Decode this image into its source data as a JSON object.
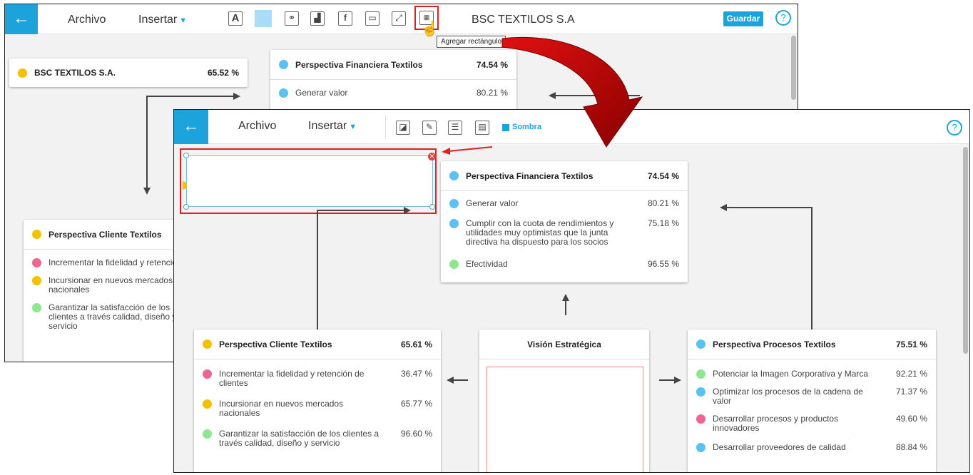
{
  "back_window": {
    "menu": {
      "archivo": "Archivo",
      "insertar": "Insertar"
    },
    "title": "BSC TEXTILOS S.A",
    "save_label": "Guardar",
    "help_label": "?",
    "tooltip": "Agregar rectángulo",
    "cards": {
      "bsc": {
        "title": "BSC TEXTILOS S.A.",
        "pct": "65.52  %"
      },
      "financiera": {
        "title": "Perspectiva Financiera Textilos",
        "pct": "74.54  %",
        "item_label": "Generar valor",
        "item_pct": "80.21  %"
      },
      "cliente": {
        "title": "Perspectiva Cliente Textilos",
        "items": [
          "Incrementar la fidelidad y retención de clientes",
          "Incursionar en nuevos mercados nacionales",
          "Garantizar la satisfacción de los clientes a través calidad, diseño y servicio"
        ]
      }
    }
  },
  "front_window": {
    "menu": {
      "archivo": "Archivo",
      "insertar": "Insertar"
    },
    "shadow_label": "Sombra",
    "help_label": "?",
    "cards": {
      "financiera": {
        "title": "Perspectiva Financiera Textilos",
        "pct": "74.54  %",
        "items": [
          {
            "label": "Generar valor",
            "pct": "80.21  %",
            "color": "#5bc0f2"
          },
          {
            "label": "Cumplir con la cuota de rendimientos y utilidades muy optimistas que la junta directiva ha dispuesto para los socios",
            "pct": "75.18  %",
            "color": "#5bc0f2"
          },
          {
            "label": "Efectividad",
            "pct": "96.55  %",
            "color": "#8ee68e"
          }
        ]
      },
      "cliente": {
        "title": "Perspectiva Cliente Textilos",
        "pct": "65.61  %",
        "items": [
          {
            "label": "Incrementar la fidelidad y retención de clientes",
            "pct": "36.47  %",
            "color": "#f0658f"
          },
          {
            "label": "Incursionar en nuevos mercados nacionales",
            "pct": "65.77  %",
            "color": "#f5c000"
          },
          {
            "label": "Garantizar la satisfacción de los clientes a través calidad, diseño y servicio",
            "pct": "96.60  %",
            "color": "#8ee68e"
          }
        ]
      },
      "vision": {
        "title": "Visión Estratégica"
      },
      "procesos": {
        "title": "Perspectiva Procesos Textilos",
        "pct": "75.51  %",
        "items": [
          {
            "label": "Potenciar la Imagen Corporativa y Marca",
            "pct": "92.21  %",
            "color": "#8ee68e"
          },
          {
            "label": "Optimizar los procesos de la cadena de valor",
            "pct": "71.37  %",
            "color": "#5bc0f2"
          },
          {
            "label": "Desarrollar procesos y productos innovadores",
            "pct": "49.60  %",
            "color": "#f0658f"
          },
          {
            "label": "Desarrollar proveedores de calidad",
            "pct": "88.84  %",
            "color": "#5bc0f2"
          }
        ]
      }
    }
  },
  "colors": {
    "accent": "#1ca3dc",
    "highlight": "#e02020",
    "yellow": "#f5c000",
    "blue": "#5bc0f2",
    "green": "#8ee68e",
    "pink": "#f0658f",
    "big_arrow": "#c30d0d"
  }
}
